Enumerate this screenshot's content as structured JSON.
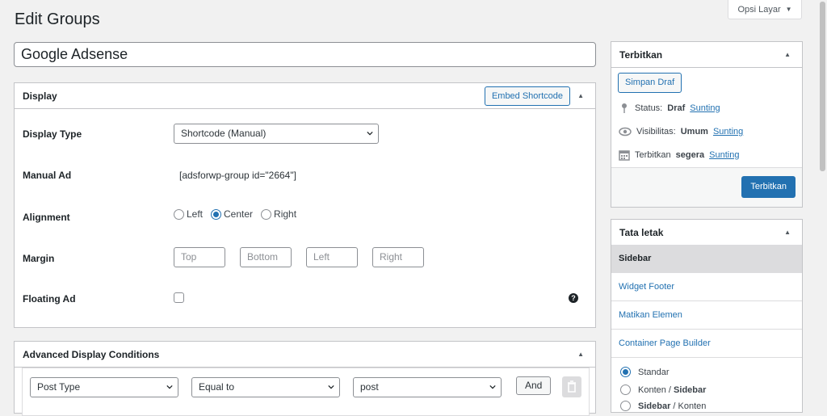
{
  "page": {
    "title": "Edit Groups",
    "screen_options": "Opsi Layar"
  },
  "post_title": "Google Adsense",
  "display_box": {
    "heading": "Display",
    "embed_button": "Embed Shortcode",
    "display_type_label": "Display Type",
    "display_type_value": "Shortcode (Manual)",
    "manual_ad_label": "Manual Ad",
    "manual_ad_value": "[adsforwp-group id=\"2664\"]",
    "alignment_label": "Alignment",
    "alignment_options": [
      "Left",
      "Center",
      "Right"
    ],
    "alignment_selected": "Center",
    "margin_label": "Margin",
    "margin_placeholders": [
      "Top",
      "Bottom",
      "Left",
      "Right"
    ],
    "floating_label": "Floating Ad",
    "floating_checked": false
  },
  "advanced_box": {
    "heading": "Advanced Display Conditions",
    "condition": {
      "type": "Post Type",
      "operator": "Equal to",
      "value": "post"
    },
    "and_button": "And"
  },
  "publish_box": {
    "heading": "Terbitkan",
    "save_draft": "Simpan Draf",
    "status_label": "Status:",
    "status_value": "Draf",
    "visibility_label": "Visibilitas:",
    "visibility_value": "Umum",
    "publish_label": "Terbitkan",
    "publish_value": "segera",
    "edit_link": "Sunting",
    "publish_button": "Terbitkan"
  },
  "layout_box": {
    "heading": "Tata letak",
    "items": [
      "Sidebar",
      "Widget Footer",
      "Matikan Elemen",
      "Container Page Builder"
    ],
    "active_item": "Sidebar",
    "radio_options": [
      "Standar",
      "Konten / Sidebar",
      "Sidebar / Konten"
    ],
    "radio_options_bold": [
      "",
      "Sidebar",
      "Sidebar"
    ],
    "radio_options_plain": [
      "Standar",
      "Konten / ",
      " / Konten"
    ],
    "radio_selected": "Standar"
  },
  "colors": {
    "accent": "#2271b1",
    "background": "#f1f1f1",
    "border": "#c3c4c7"
  },
  "icons": [
    "pin-icon",
    "eye-icon",
    "calendar-icon",
    "help-icon",
    "trash-icon",
    "chevron-down-icon",
    "toggle-up-icon"
  ]
}
